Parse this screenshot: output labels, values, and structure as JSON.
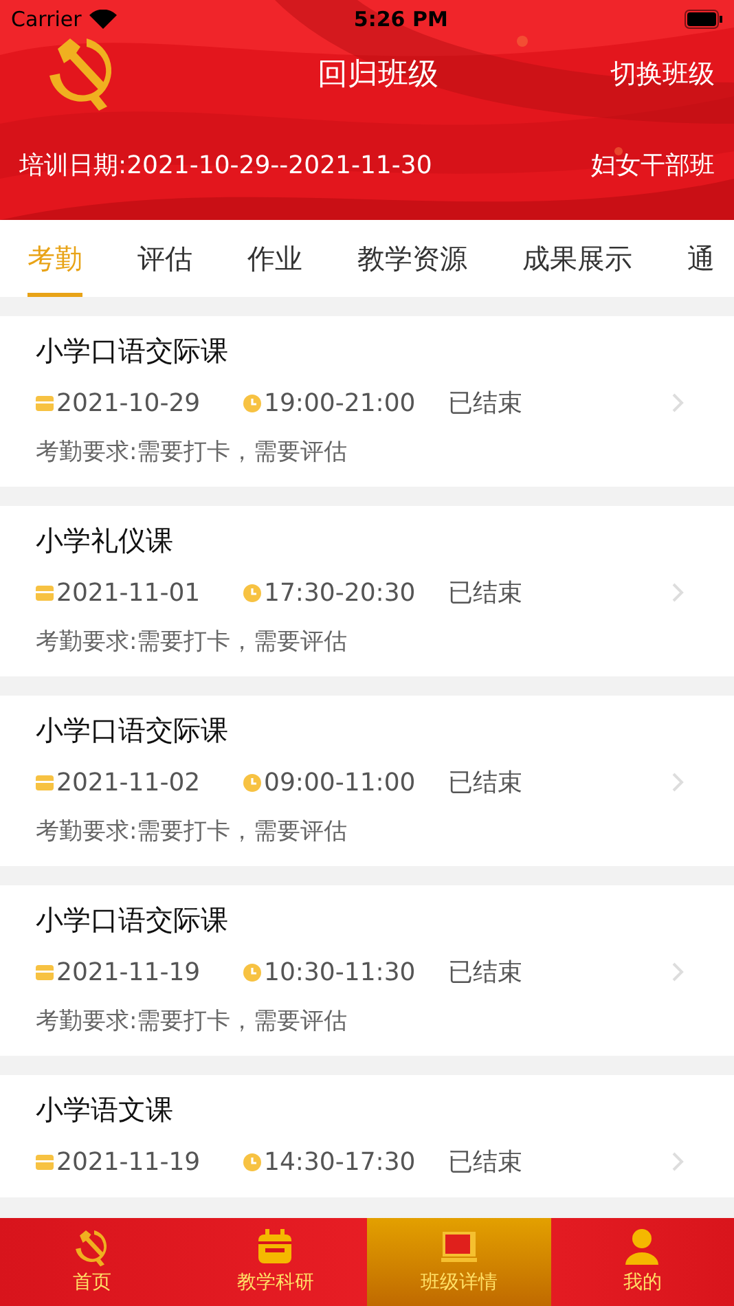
{
  "status_bar": {
    "carrier": "Carrier",
    "time": "5:26 PM"
  },
  "header": {
    "title": "回归班级",
    "action": "切换班级",
    "training_dates": "培训日期:2021-10-29--2021-11-30",
    "class_name": "妇女干部班"
  },
  "tabs": [
    {
      "label": "考勤",
      "selected": true
    },
    {
      "label": "评估",
      "selected": false
    },
    {
      "label": "作业",
      "selected": false
    },
    {
      "label": "教学资源",
      "selected": false
    },
    {
      "label": "成果展示",
      "selected": false
    },
    {
      "label": "通",
      "selected": false
    }
  ],
  "sessions": [
    {
      "title": "小学口语交际课",
      "date": "2021-10-29",
      "time": "19:00-21:00",
      "status": "已结束",
      "requirement": "考勤要求:需要打卡，需要评估"
    },
    {
      "title": "小学礼仪课",
      "date": "2021-11-01",
      "time": "17:30-20:30",
      "status": "已结束",
      "requirement": "考勤要求:需要打卡，需要评估"
    },
    {
      "title": "小学口语交际课",
      "date": "2021-11-02",
      "time": "09:00-11:00",
      "status": "已结束",
      "requirement": "考勤要求:需要打卡，需要评估"
    },
    {
      "title": "小学口语交际课",
      "date": "2021-11-19",
      "time": "10:30-11:30",
      "status": "已结束",
      "requirement": "考勤要求:需要打卡，需要评估"
    },
    {
      "title": "小学语文课",
      "date": "2021-11-19",
      "time": "14:30-17:30",
      "status": "已结束"
    }
  ],
  "bottom_nav": [
    {
      "label": "首页",
      "selected": false
    },
    {
      "label": "教学科研",
      "selected": false
    },
    {
      "label": "班级详情",
      "selected": true
    },
    {
      "label": "我的",
      "selected": false
    }
  ]
}
